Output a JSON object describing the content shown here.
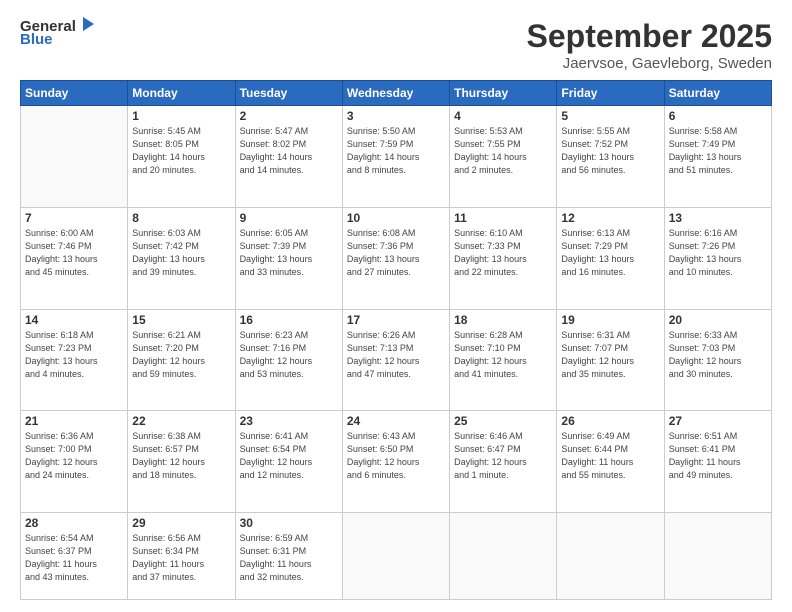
{
  "header": {
    "logo_general": "General",
    "logo_blue": "Blue",
    "month": "September 2025",
    "location": "Jaervsoe, Gaevleborg, Sweden"
  },
  "weekdays": [
    "Sunday",
    "Monday",
    "Tuesday",
    "Wednesday",
    "Thursday",
    "Friday",
    "Saturday"
  ],
  "weeks": [
    [
      {
        "day": "",
        "info": ""
      },
      {
        "day": "1",
        "info": "Sunrise: 5:45 AM\nSunset: 8:05 PM\nDaylight: 14 hours\nand 20 minutes."
      },
      {
        "day": "2",
        "info": "Sunrise: 5:47 AM\nSunset: 8:02 PM\nDaylight: 14 hours\nand 14 minutes."
      },
      {
        "day": "3",
        "info": "Sunrise: 5:50 AM\nSunset: 7:59 PM\nDaylight: 14 hours\nand 8 minutes."
      },
      {
        "day": "4",
        "info": "Sunrise: 5:53 AM\nSunset: 7:55 PM\nDaylight: 14 hours\nand 2 minutes."
      },
      {
        "day": "5",
        "info": "Sunrise: 5:55 AM\nSunset: 7:52 PM\nDaylight: 13 hours\nand 56 minutes."
      },
      {
        "day": "6",
        "info": "Sunrise: 5:58 AM\nSunset: 7:49 PM\nDaylight: 13 hours\nand 51 minutes."
      }
    ],
    [
      {
        "day": "7",
        "info": "Sunrise: 6:00 AM\nSunset: 7:46 PM\nDaylight: 13 hours\nand 45 minutes."
      },
      {
        "day": "8",
        "info": "Sunrise: 6:03 AM\nSunset: 7:42 PM\nDaylight: 13 hours\nand 39 minutes."
      },
      {
        "day": "9",
        "info": "Sunrise: 6:05 AM\nSunset: 7:39 PM\nDaylight: 13 hours\nand 33 minutes."
      },
      {
        "day": "10",
        "info": "Sunrise: 6:08 AM\nSunset: 7:36 PM\nDaylight: 13 hours\nand 27 minutes."
      },
      {
        "day": "11",
        "info": "Sunrise: 6:10 AM\nSunset: 7:33 PM\nDaylight: 13 hours\nand 22 minutes."
      },
      {
        "day": "12",
        "info": "Sunrise: 6:13 AM\nSunset: 7:29 PM\nDaylight: 13 hours\nand 16 minutes."
      },
      {
        "day": "13",
        "info": "Sunrise: 6:16 AM\nSunset: 7:26 PM\nDaylight: 13 hours\nand 10 minutes."
      }
    ],
    [
      {
        "day": "14",
        "info": "Sunrise: 6:18 AM\nSunset: 7:23 PM\nDaylight: 13 hours\nand 4 minutes."
      },
      {
        "day": "15",
        "info": "Sunrise: 6:21 AM\nSunset: 7:20 PM\nDaylight: 12 hours\nand 59 minutes."
      },
      {
        "day": "16",
        "info": "Sunrise: 6:23 AM\nSunset: 7:16 PM\nDaylight: 12 hours\nand 53 minutes."
      },
      {
        "day": "17",
        "info": "Sunrise: 6:26 AM\nSunset: 7:13 PM\nDaylight: 12 hours\nand 47 minutes."
      },
      {
        "day": "18",
        "info": "Sunrise: 6:28 AM\nSunset: 7:10 PM\nDaylight: 12 hours\nand 41 minutes."
      },
      {
        "day": "19",
        "info": "Sunrise: 6:31 AM\nSunset: 7:07 PM\nDaylight: 12 hours\nand 35 minutes."
      },
      {
        "day": "20",
        "info": "Sunrise: 6:33 AM\nSunset: 7:03 PM\nDaylight: 12 hours\nand 30 minutes."
      }
    ],
    [
      {
        "day": "21",
        "info": "Sunrise: 6:36 AM\nSunset: 7:00 PM\nDaylight: 12 hours\nand 24 minutes."
      },
      {
        "day": "22",
        "info": "Sunrise: 6:38 AM\nSunset: 6:57 PM\nDaylight: 12 hours\nand 18 minutes."
      },
      {
        "day": "23",
        "info": "Sunrise: 6:41 AM\nSunset: 6:54 PM\nDaylight: 12 hours\nand 12 minutes."
      },
      {
        "day": "24",
        "info": "Sunrise: 6:43 AM\nSunset: 6:50 PM\nDaylight: 12 hours\nand 6 minutes."
      },
      {
        "day": "25",
        "info": "Sunrise: 6:46 AM\nSunset: 6:47 PM\nDaylight: 12 hours\nand 1 minute."
      },
      {
        "day": "26",
        "info": "Sunrise: 6:49 AM\nSunset: 6:44 PM\nDaylight: 11 hours\nand 55 minutes."
      },
      {
        "day": "27",
        "info": "Sunrise: 6:51 AM\nSunset: 6:41 PM\nDaylight: 11 hours\nand 49 minutes."
      }
    ],
    [
      {
        "day": "28",
        "info": "Sunrise: 6:54 AM\nSunset: 6:37 PM\nDaylight: 11 hours\nand 43 minutes."
      },
      {
        "day": "29",
        "info": "Sunrise: 6:56 AM\nSunset: 6:34 PM\nDaylight: 11 hours\nand 37 minutes."
      },
      {
        "day": "30",
        "info": "Sunrise: 6:59 AM\nSunset: 6:31 PM\nDaylight: 11 hours\nand 32 minutes."
      },
      {
        "day": "",
        "info": ""
      },
      {
        "day": "",
        "info": ""
      },
      {
        "day": "",
        "info": ""
      },
      {
        "day": "",
        "info": ""
      }
    ]
  ]
}
